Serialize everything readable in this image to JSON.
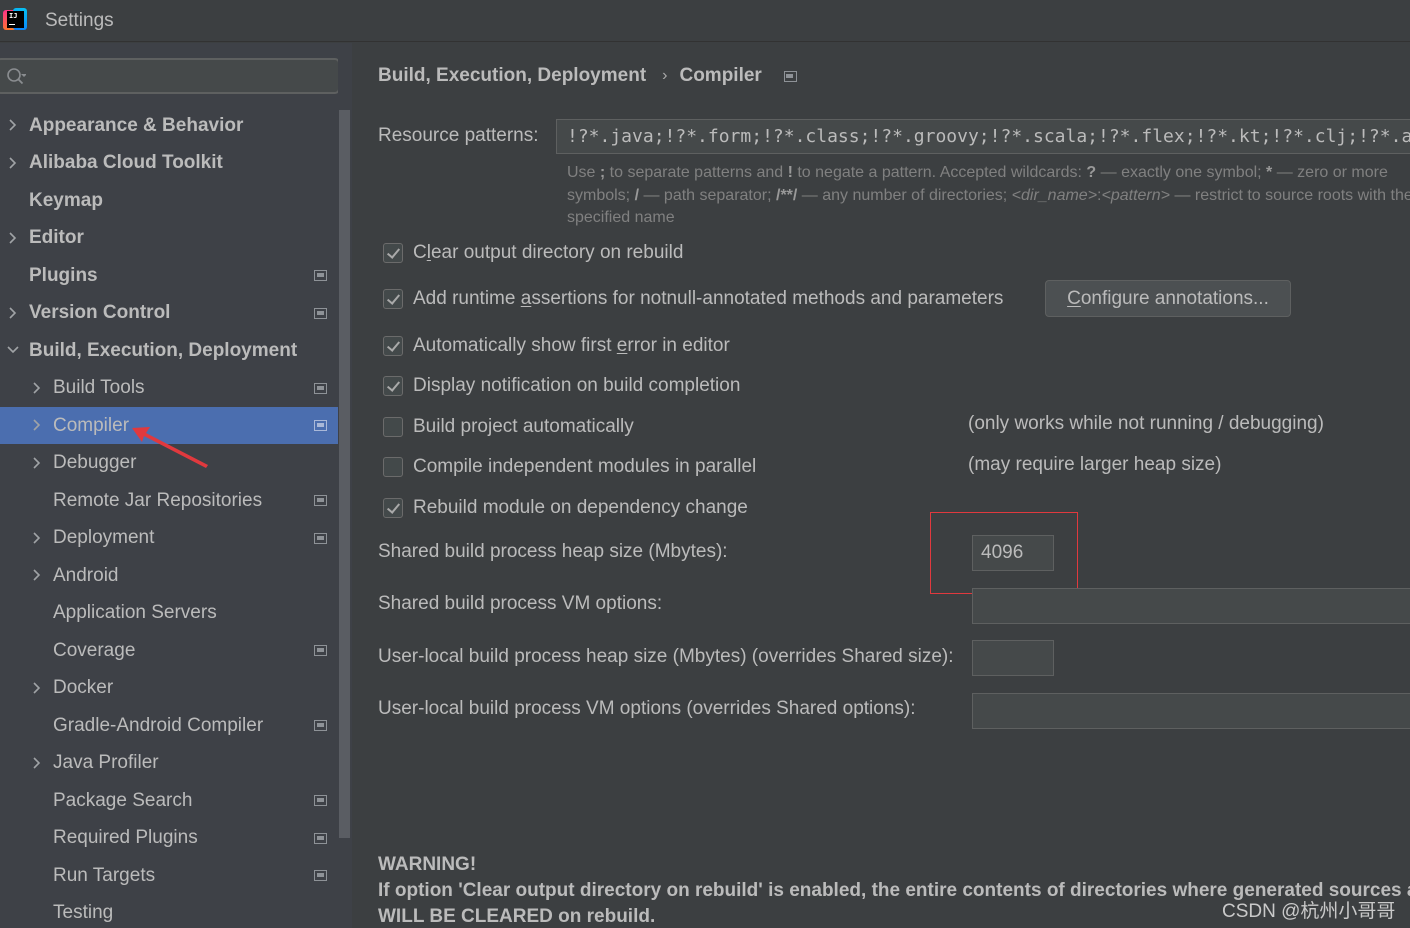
{
  "window": {
    "title": "Settings",
    "app_icon": "intellij-idea-icon"
  },
  "search": {
    "placeholder": "",
    "value": ""
  },
  "sidebar": {
    "items": [
      {
        "label": "Appearance & Behavior",
        "level": 0,
        "bold": true,
        "chevron": "right",
        "project_icon": false,
        "selected": false
      },
      {
        "label": "Alibaba Cloud Toolkit",
        "level": 0,
        "bold": true,
        "chevron": "right",
        "project_icon": false,
        "selected": false
      },
      {
        "label": "Keymap",
        "level": 0,
        "bold": true,
        "chevron": null,
        "project_icon": false,
        "selected": false
      },
      {
        "label": "Editor",
        "level": 0,
        "bold": true,
        "chevron": "right",
        "project_icon": false,
        "selected": false
      },
      {
        "label": "Plugins",
        "level": 0,
        "bold": true,
        "chevron": null,
        "project_icon": true,
        "selected": false
      },
      {
        "label": "Version Control",
        "level": 0,
        "bold": true,
        "chevron": "right",
        "project_icon": true,
        "selected": false
      },
      {
        "label": "Build, Execution, Deployment",
        "level": 0,
        "bold": true,
        "chevron": "down",
        "project_icon": false,
        "selected": false
      },
      {
        "label": "Build Tools",
        "level": 1,
        "bold": false,
        "chevron": "right",
        "project_icon": true,
        "selected": false
      },
      {
        "label": "Compiler",
        "level": 1,
        "bold": false,
        "chevron": "right",
        "project_icon": true,
        "selected": true
      },
      {
        "label": "Debugger",
        "level": 1,
        "bold": false,
        "chevron": "right",
        "project_icon": false,
        "selected": false
      },
      {
        "label": "Remote Jar Repositories",
        "level": 1,
        "bold": false,
        "chevron": null,
        "project_icon": true,
        "selected": false
      },
      {
        "label": "Deployment",
        "level": 1,
        "bold": false,
        "chevron": "right",
        "project_icon": true,
        "selected": false
      },
      {
        "label": "Android",
        "level": 1,
        "bold": false,
        "chevron": "right",
        "project_icon": false,
        "selected": false
      },
      {
        "label": "Application Servers",
        "level": 1,
        "bold": false,
        "chevron": null,
        "project_icon": false,
        "selected": false
      },
      {
        "label": "Coverage",
        "level": 1,
        "bold": false,
        "chevron": null,
        "project_icon": true,
        "selected": false
      },
      {
        "label": "Docker",
        "level": 1,
        "bold": false,
        "chevron": "right",
        "project_icon": false,
        "selected": false
      },
      {
        "label": "Gradle-Android Compiler",
        "level": 1,
        "bold": false,
        "chevron": null,
        "project_icon": true,
        "selected": false
      },
      {
        "label": "Java Profiler",
        "level": 1,
        "bold": false,
        "chevron": "right",
        "project_icon": false,
        "selected": false
      },
      {
        "label": "Package Search",
        "level": 1,
        "bold": false,
        "chevron": null,
        "project_icon": true,
        "selected": false
      },
      {
        "label": "Required Plugins",
        "level": 1,
        "bold": false,
        "chevron": null,
        "project_icon": true,
        "selected": false
      },
      {
        "label": "Run Targets",
        "level": 1,
        "bold": false,
        "chevron": null,
        "project_icon": true,
        "selected": false
      },
      {
        "label": "Testing",
        "level": 1,
        "bold": false,
        "chevron": null,
        "project_icon": false,
        "selected": false
      }
    ]
  },
  "breadcrumb": {
    "parent": "Build, Execution, Deployment",
    "separator": "›",
    "current": "Compiler"
  },
  "resource_patterns": {
    "label": "Resource patterns:",
    "value": "!?*.java;!?*.form;!?*.class;!?*.groovy;!?*.scala;!?*.flex;!?*.kt;!?*.clj;!?*.aj",
    "hint_line1_a": "Use ",
    "hint_line1_b": ";",
    "hint_line1_c": " to separate patterns and ",
    "hint_line1_d": "!",
    "hint_line1_e": " to negate a pattern. Accepted wildcards: ",
    "hint_line1_f": "?",
    "hint_line1_g": " — exactly one symbol; ",
    "hint_line1_h": "*",
    "hint_line1_i": " — zero or more",
    "hint_line2_a": "symbols; ",
    "hint_line2_b": "/",
    "hint_line2_c": " — path separator; ",
    "hint_line2_d": "/**/",
    "hint_line2_e": " — any number of directories; ",
    "hint_line2_f": "<dir_name>",
    "hint_line2_g": ":",
    "hint_line2_h": "<pattern>",
    "hint_line2_i": " — restrict to source roots with the",
    "hint_line3": "specified name"
  },
  "options": [
    {
      "pre": "C",
      "mnemonic": "l",
      "post": "ear output directory on rebuild",
      "checked": true
    },
    {
      "pre": "Add runtime ",
      "mnemonic": "a",
      "post": "ssertions for notnull-annotated methods and parameters",
      "checked": true
    },
    {
      "pre": "Automatically show first ",
      "mnemonic": "e",
      "post": "rror in editor",
      "checked": true
    },
    {
      "pre": "Display notification on build completion",
      "mnemonic": "",
      "post": "",
      "checked": true
    },
    {
      "pre": "Build project automatically",
      "mnemonic": "",
      "post": "",
      "checked": false
    },
    {
      "pre": "Compile independent modules in parallel",
      "mnemonic": "",
      "post": "",
      "checked": false
    },
    {
      "pre": "Rebuild module on dependency change",
      "mnemonic": "",
      "post": "",
      "checked": true
    }
  ],
  "configure_button": {
    "mnemonic": "C",
    "rest": "onfigure annotations..."
  },
  "notes": {
    "build_auto": "(only works while not running / debugging)",
    "parallel": "(may require larger heap size)"
  },
  "fields": {
    "shared_heap_label": "Shared build process heap size (Mbytes):",
    "shared_heap_value": "4096",
    "shared_vm_label": "Shared build process VM options:",
    "shared_vm_value": "",
    "user_heap_label": "User-local build process heap size (Mbytes) (overrides Shared size):",
    "user_heap_value": "",
    "user_vm_label": "User-local build process VM options (overrides Shared options):",
    "user_vm_value": ""
  },
  "warning": {
    "title": "WARNING!",
    "line1": "If option 'Clear output directory on rebuild' is enabled, the entire contents of directories where generated sources are stored",
    "line2": "WILL BE CLEARED on rebuild."
  },
  "watermark": "CSDN @杭州小哥哥",
  "colors": {
    "selection": "#4b6eaf",
    "annotation_red": "#e0393e",
    "background": "#3c3f41",
    "sidebar_bg": "#3e4147",
    "text": "#bbbbbb"
  }
}
